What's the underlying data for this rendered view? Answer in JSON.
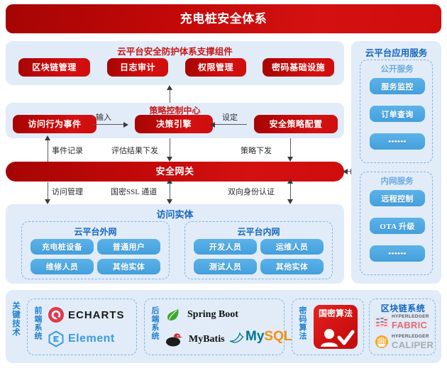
{
  "title": {
    "text": "充电桩安全体系"
  },
  "support": {
    "title": "云平台安全防护体系支撑组件",
    "items": [
      {
        "label": "区块链管理"
      },
      {
        "label": "日志审计"
      },
      {
        "label": "权限管理"
      },
      {
        "label": "密码基础设施"
      }
    ]
  },
  "policy": {
    "title": "策略控制中心",
    "nodes": [
      {
        "label": "访问行为事件"
      },
      {
        "label": "决策引擎"
      },
      {
        "label": "安全策略配置"
      }
    ],
    "edges": [
      {
        "label": "输入"
      },
      {
        "label": "设定"
      }
    ]
  },
  "gateway": {
    "label": "安全网关"
  },
  "flow_labels": {
    "event_record": "事件记录",
    "assessment_result": "评估结果下发",
    "policy_dispatch": "策略下发",
    "access_management": "访问管理",
    "sm_ssl_channel": "国密SSL 通道",
    "mutual_auth": "双向身份认证"
  },
  "entity": {
    "title": "访问实体",
    "groups": [
      {
        "title": "云平台外网",
        "items": [
          "充电桩设备",
          "普通用户",
          "维修人员",
          "其他实体"
        ]
      },
      {
        "title": "云平台内网",
        "items": [
          "开发人员",
          "运维人员",
          "测试人员",
          "其他实体"
        ]
      }
    ]
  },
  "services": {
    "title": "云平台应用服务",
    "groups": [
      {
        "title": "公开服务",
        "items": [
          "服务监控",
          "订单查询",
          "••••••"
        ]
      },
      {
        "title": "内网服务",
        "items": [
          "远程控制",
          "OTA 升级",
          "••••••"
        ]
      }
    ]
  },
  "tech": {
    "vertical_label": "关键技术",
    "groups": [
      {
        "vertical_label": "前端系统",
        "items": [
          {
            "name": "ECHARTS",
            "icon": "echarts-icon"
          },
          {
            "name": "Element",
            "icon": "element-icon"
          }
        ]
      },
      {
        "vertical_label": "后端系统",
        "items": [
          {
            "name": "Spring Boot",
            "icon": "spring-leaf-icon"
          },
          {
            "name": "MyBatis",
            "icon": "mybatis-bird-icon"
          },
          {
            "name": "MySQL",
            "icon": "mysql-dolphin-icon"
          }
        ]
      },
      {
        "vertical_label": "密码算法",
        "items": [
          {
            "name": "国密算法",
            "icon": "sm-crypto-id-icon"
          }
        ]
      },
      {
        "title": "区块链系统",
        "items": [
          {
            "name": "HYPERLEDGER",
            "sub": "FABRIC",
            "icon": "hyperledger-fabric-icon"
          },
          {
            "name": "HYPERLEDGER",
            "sub": "CALIPER",
            "icon": "hyperledger-caliper-icon"
          }
        ]
      }
    ]
  },
  "colors": {
    "red": "#c20808",
    "panel_blue": "#e1ecf8",
    "pill_blue": "#45a0dd",
    "title_blue": "#1565c0",
    "dash_blue": "#7fb4e4"
  }
}
